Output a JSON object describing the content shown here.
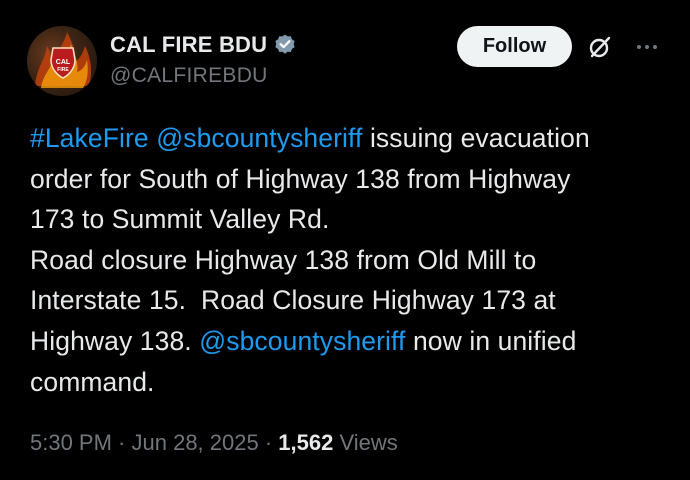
{
  "author": {
    "display_name": "CAL FIRE BDU",
    "handle": "@CALFIREBDU",
    "avatar_icon": "cal-fire-logo-icon",
    "verified_icon": "verified-badge-icon"
  },
  "actions": {
    "follow_label": "Follow",
    "grok_icon": "grok-icon",
    "more_icon": "more-options-icon"
  },
  "tweet": {
    "lines": [
      [
        {
          "text": "#LakeFire",
          "link": true
        },
        {
          "text": " ",
          "link": false
        },
        {
          "text": "@sbcountysheriff",
          "link": true
        },
        {
          "text": " issuing evacuation",
          "link": false
        }
      ],
      [
        {
          "text": "order for South of Highway 138 from Highway",
          "link": false
        }
      ],
      [
        {
          "text": "173 to Summit Valley Rd.",
          "link": false
        }
      ],
      [
        {
          "text": "Road closure Highway 138 from Old Mill to",
          "link": false
        }
      ],
      [
        {
          "text": "Interstate 15.  Road Closure Highway 173 at",
          "link": false
        }
      ],
      [
        {
          "text": "Highway 138. ",
          "link": false
        },
        {
          "text": "@sbcountysheriff",
          "link": true
        },
        {
          "text": " now in unified",
          "link": false
        }
      ],
      [
        {
          "text": "command.",
          "link": false
        }
      ]
    ]
  },
  "meta": {
    "time": "5:30 PM",
    "separator": " · ",
    "date": "Jun 28, 2025",
    "views_count": "1,562",
    "views_label": " Views"
  },
  "colors": {
    "background": "#000000",
    "text": "#e7e9ea",
    "secondary": "#71767b",
    "link": "#1d9bf0",
    "follow_bg": "#eff3f4"
  }
}
